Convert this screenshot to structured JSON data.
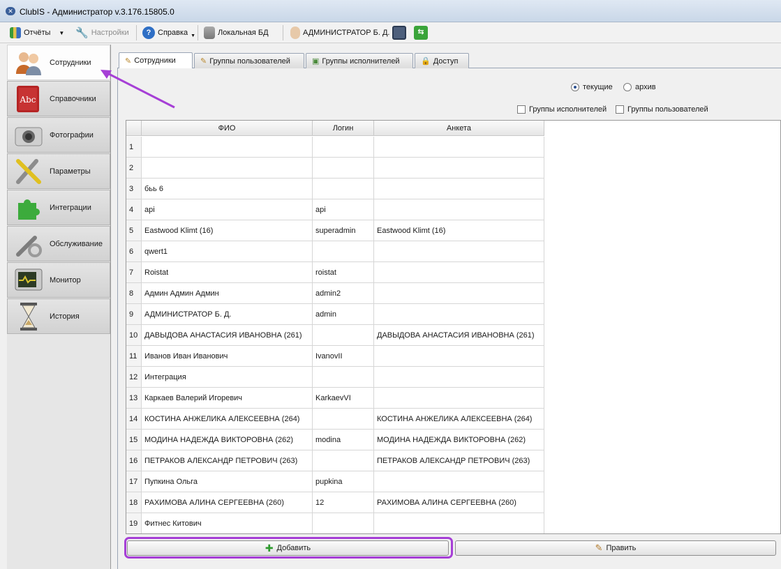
{
  "window": {
    "title": "ClubIS - Администратор v.3.176.15805.0"
  },
  "toolbar": {
    "reports": "Отчёты",
    "settings": "Настройки",
    "help": "Справка",
    "database": "Локальная БД",
    "user": "АДМИНИСТРАТОР Б. Д."
  },
  "sidebar": {
    "items": [
      {
        "label": "Сотрудники",
        "icon": "users-icon"
      },
      {
        "label": "Справочники",
        "icon": "book-icon"
      },
      {
        "label": "Фотографии",
        "icon": "camera-icon"
      },
      {
        "label": "Параметры",
        "icon": "tools-icon"
      },
      {
        "label": "Интеграции",
        "icon": "puzzle-icon"
      },
      {
        "label": "Обслуживание",
        "icon": "wrench-gear-icon"
      },
      {
        "label": "Монитор",
        "icon": "monitor-icon"
      },
      {
        "label": "История",
        "icon": "hourglass-icon"
      }
    ]
  },
  "tabs": [
    "Сотрудники",
    "Группы пользователей",
    "Группы исполнителей",
    "Доступ"
  ],
  "filters": {
    "current": "текущие",
    "archive": "архив",
    "executor_groups": "Группы исполнителей",
    "user_groups": "Группы пользователей"
  },
  "table": {
    "columns": [
      "ФИО",
      "Логин",
      "Анкета"
    ],
    "rows": [
      {
        "n": "1",
        "fio": "",
        "login": "",
        "profile": ""
      },
      {
        "n": "2",
        "fio": "",
        "login": "",
        "profile": ""
      },
      {
        "n": "3",
        "fio": " бьь 6",
        "login": "",
        "profile": ""
      },
      {
        "n": "4",
        "fio": "api",
        "login": "api",
        "profile": ""
      },
      {
        "n": "5",
        "fio": "Eastwood Klimt  (16)",
        "login": "superadmin",
        "profile": "Eastwood Klimt  (16)"
      },
      {
        "n": "6",
        "fio": "qwert1",
        "login": "",
        "profile": ""
      },
      {
        "n": "7",
        "fio": "Roistat",
        "login": "roistat",
        "profile": ""
      },
      {
        "n": "8",
        "fio": "Админ Админ Админ",
        "login": "admin2",
        "profile": ""
      },
      {
        "n": "9",
        "fio": "АДМИНИСТРАТОР Б. Д.",
        "login": "admin",
        "profile": ""
      },
      {
        "n": "10",
        "fio": "ДАВЫДОВА АНАСТАСИЯ ИВАНОВНА (261)",
        "login": "",
        "profile": "ДАВЫДОВА АНАСТАСИЯ ИВАНОВНА (261)"
      },
      {
        "n": "11",
        "fio": "Иванов Иван Иванович",
        "login": "IvanovII",
        "profile": ""
      },
      {
        "n": "12",
        "fio": "Интеграция",
        "login": "",
        "profile": ""
      },
      {
        "n": "13",
        "fio": "Каркаев Валерий Игоревич",
        "login": "KarkaevVI",
        "profile": ""
      },
      {
        "n": "14",
        "fio": "КОСТИНА АНЖЕЛИКА АЛЕКСЕЕВНА (264)",
        "login": "",
        "profile": "КОСТИНА АНЖЕЛИКА АЛЕКСЕЕВНА (264)"
      },
      {
        "n": "15",
        "fio": "МОДИНА НАДЕЖДА ВИКТОРОВНА (262)",
        "login": "modina",
        "profile": "МОДИНА НАДЕЖДА ВИКТОРОВНА (262)"
      },
      {
        "n": "16",
        "fio": "ПЕТРАКОВ АЛЕКСАНДР ПЕТРОВИЧ (263)",
        "login": "",
        "profile": "ПЕТРАКОВ АЛЕКСАНДР ПЕТРОВИЧ (263)"
      },
      {
        "n": "17",
        "fio": "Пупкина Ольга",
        "login": "pupkina",
        "profile": ""
      },
      {
        "n": "18",
        "fio": "РАХИМОВА АЛИНА СЕРГЕЕВНА (260)",
        "login": "12",
        "profile": "РАХИМОВА АЛИНА СЕРГЕЕВНА (260)"
      },
      {
        "n": "19",
        "fio": "Фитнес Китович",
        "login": "",
        "profile": ""
      }
    ]
  },
  "buttons": {
    "add": "Добавить",
    "edit": "Править"
  },
  "colors": {
    "annotation": "#a63fd6"
  }
}
